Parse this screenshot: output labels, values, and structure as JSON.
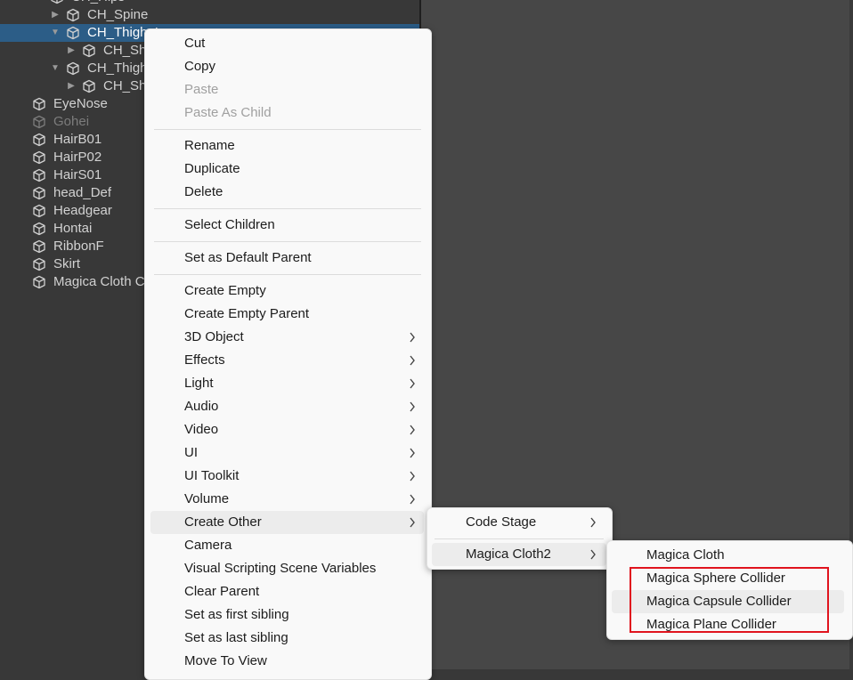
{
  "hierarchy": {
    "items": [
      {
        "label": "CH_Hips",
        "indent": 1,
        "fold": "expanded"
      },
      {
        "label": "CH_Spine",
        "indent": 2,
        "fold": "collapsed"
      },
      {
        "label": "CH_Thigh_L",
        "indent": 2,
        "fold": "expanded",
        "selected": true
      },
      {
        "label": "CH_Shin_L",
        "indent": 3,
        "fold": "collapsed"
      },
      {
        "label": "CH_Thigh_R",
        "indent": 2,
        "fold": "expanded"
      },
      {
        "label": "CH_Shin_R",
        "indent": 3,
        "fold": "collapsed"
      },
      {
        "label": "EyeNose",
        "indent": 0,
        "fold": "none"
      },
      {
        "label": "Gohei",
        "indent": 0,
        "fold": "none",
        "inactive": true
      },
      {
        "label": "HairB01",
        "indent": 0,
        "fold": "none"
      },
      {
        "label": "HairP02",
        "indent": 0,
        "fold": "none"
      },
      {
        "label": "HairS01",
        "indent": 0,
        "fold": "none"
      },
      {
        "label": "head_Def",
        "indent": 0,
        "fold": "none"
      },
      {
        "label": "Headgear",
        "indent": 0,
        "fold": "none"
      },
      {
        "label": "Hontai",
        "indent": 0,
        "fold": "none"
      },
      {
        "label": "RibbonF",
        "indent": 0,
        "fold": "none"
      },
      {
        "label": "Skirt",
        "indent": 0,
        "fold": "none"
      },
      {
        "label": "Magica Cloth Colliders",
        "indent": 0,
        "fold": "none"
      }
    ]
  },
  "context_menu": {
    "groups": [
      [
        {
          "label": "Cut"
        },
        {
          "label": "Copy"
        },
        {
          "label": "Paste",
          "disabled": true
        },
        {
          "label": "Paste As Child",
          "disabled": true
        }
      ],
      [
        {
          "label": "Rename"
        },
        {
          "label": "Duplicate"
        },
        {
          "label": "Delete"
        }
      ],
      [
        {
          "label": "Select Children"
        }
      ],
      [
        {
          "label": "Set as Default Parent"
        }
      ],
      [
        {
          "label": "Create Empty"
        },
        {
          "label": "Create Empty Parent"
        },
        {
          "label": "3D Object",
          "submenu": true
        },
        {
          "label": "Effects",
          "submenu": true
        },
        {
          "label": "Light",
          "submenu": true
        },
        {
          "label": "Audio",
          "submenu": true
        },
        {
          "label": "Video",
          "submenu": true
        },
        {
          "label": "UI",
          "submenu": true
        },
        {
          "label": "UI Toolkit",
          "submenu": true
        },
        {
          "label": "Volume",
          "submenu": true
        },
        {
          "label": "Create Other",
          "submenu": true,
          "highlighted": true
        },
        {
          "label": "Camera"
        },
        {
          "label": "Visual Scripting Scene Variables"
        },
        {
          "label": "Clear Parent"
        },
        {
          "label": "Set as first sibling"
        },
        {
          "label": "Set as last sibling"
        },
        {
          "label": "Move To View"
        }
      ]
    ]
  },
  "create_other_menu": {
    "items": [
      {
        "label": "Code Stage",
        "submenu": true
      },
      {
        "label": "Magica Cloth2",
        "submenu": true,
        "highlighted": true
      }
    ]
  },
  "magica_menu": {
    "items": [
      {
        "label": "Magica Cloth"
      },
      {
        "label": "Magica Sphere Collider"
      },
      {
        "label": "Magica Capsule Collider",
        "highlighted": true
      },
      {
        "label": "Magica Plane Collider"
      }
    ]
  },
  "colors": {
    "selection": "#2c5d87",
    "annotation_box": "#e0141e",
    "menu_background": "#f9f9f9"
  }
}
